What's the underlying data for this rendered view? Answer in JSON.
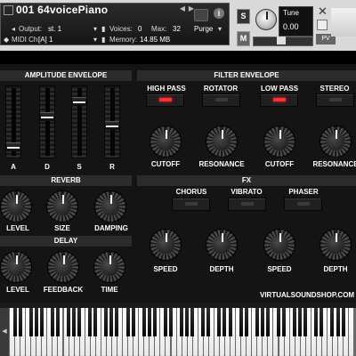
{
  "header": {
    "instrument_name": "001 64voicePiano",
    "output_label": "Output:",
    "output_value": "st. 1",
    "voices_label": "Voices:",
    "voices_value": "0",
    "max_label": "Max:",
    "max_value": "32",
    "purge_label": "Purge",
    "midi_label": "MIDI Ch:",
    "midi_value": "[A]  1",
    "memory_label": "Memory:",
    "memory_value": "14.85 MB",
    "solo_label": "S",
    "mute_label": "M",
    "tune_label": "Tune",
    "tune_value": "0.00",
    "pv_label": "PV",
    "close_glyph": "✕"
  },
  "amplitude_envelope": {
    "title": "AMPLITUDE ENVELOPE",
    "faders": [
      {
        "label": "A",
        "level": 0.1
      },
      {
        "label": "D",
        "level": 0.6
      },
      {
        "label": "S",
        "level": 0.85
      },
      {
        "label": "R",
        "level": 0.45
      }
    ]
  },
  "filter_envelope": {
    "title": "FILTER ENVELOPE",
    "buttons": [
      {
        "label": "HIGH PASS",
        "on": true
      },
      {
        "label": "ROTATOR",
        "on": false
      },
      {
        "label": "LOW PASS",
        "on": true
      },
      {
        "label": "STEREO",
        "on": false
      }
    ],
    "knobs": [
      "CUTOFF",
      "RESONANCE",
      "CUTOFF",
      "RESONANCE"
    ]
  },
  "reverb": {
    "title": "REVERB",
    "knobs": [
      "LEVEL",
      "SIZE",
      "DAMPING"
    ]
  },
  "delay": {
    "title": "DELAY",
    "knobs": [
      "LEVEL",
      "FEEDBACK",
      "TIME"
    ]
  },
  "fx": {
    "title": "FX",
    "buttons": [
      "CHORUS",
      "VIBRATO",
      "PHASER"
    ],
    "knobs": [
      "SPEED",
      "DEPTH",
      "SPEED",
      "DEPTH"
    ]
  },
  "footer": {
    "website": "VIRTUALSOUNDSHOP.COM"
  },
  "keyboard": {
    "scroll_glyph": "◀"
  },
  "colors": {
    "panel": "#141414",
    "header": "#d9d9d9",
    "led_on": "#ff3030"
  }
}
